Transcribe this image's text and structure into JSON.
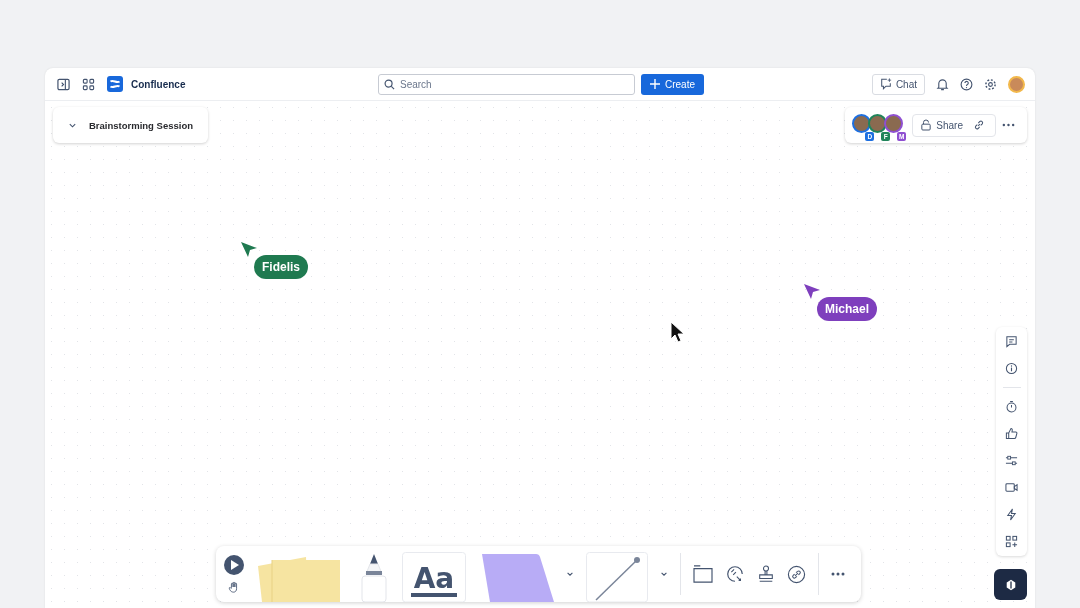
{
  "app": {
    "name": "Confluence"
  },
  "search": {
    "placeholder": "Search"
  },
  "create_button": {
    "label": "Create"
  },
  "chat_button": {
    "label": "Chat"
  },
  "board": {
    "title": "Brainstorming Session"
  },
  "collaborators": [
    {
      "initial": "D",
      "color": "#1d6fe0"
    },
    {
      "initial": "F",
      "color": "#1f845a"
    },
    {
      "initial": "M",
      "color": "#8f4fd1"
    }
  ],
  "share_button": {
    "label": "Share"
  },
  "cursors": [
    {
      "name": "Fidelis",
      "color": "#1f7a50"
    },
    {
      "name": "Michael",
      "color": "#7e3fbd"
    }
  ],
  "text_tool": {
    "label": "Aa"
  }
}
